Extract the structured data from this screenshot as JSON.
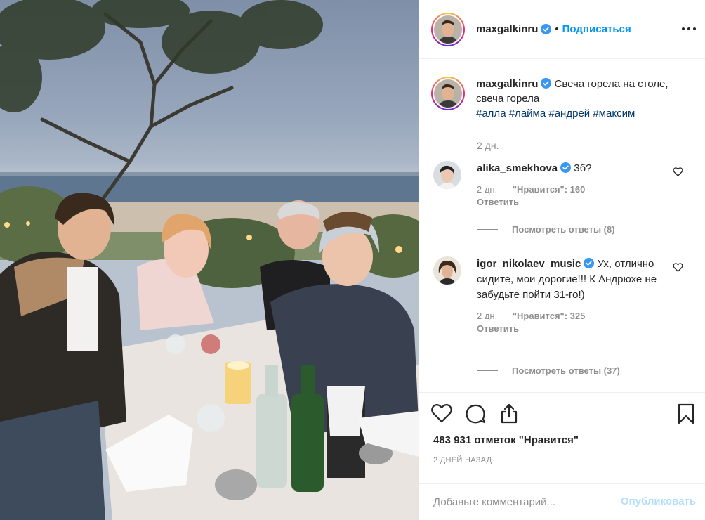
{
  "photo": {
    "alt": ""
  },
  "header": {
    "username": "maxgalkinru",
    "separator": "•",
    "follow_label": "Подписаться"
  },
  "caption": {
    "username": "maxgalkinru",
    "text": "Свеча горела на столе, свеча горела",
    "hashtags": [
      "#алла",
      "#лайма",
      "#андрей",
      "#максим"
    ],
    "time": "2 дн."
  },
  "comments": [
    {
      "username": "alika_smekhova",
      "text": "3б?",
      "time": "2 дн.",
      "likes": "\"Нравится\": 160",
      "reply": "Ответить",
      "view_replies": "Посмотреть ответы (8)"
    },
    {
      "username": "igor_nikolaev_music",
      "text": "Ух, отлично сидите, мои дорогие!!! К Андрюхе не забудьте пойти 31-го!)",
      "time": "2 дн.",
      "likes": "\"Нравится\": 325",
      "reply": "Ответить",
      "view_replies": "Посмотреть ответы (37)"
    }
  ],
  "actions": {
    "icons": [
      "heart-icon",
      "comment-icon",
      "share-icon",
      "bookmark-icon"
    ],
    "likes_text": "483 931 отметок \"Нравится\"",
    "posted_ago": "2 ДНЕЙ НАЗАД"
  },
  "add_comment": {
    "placeholder": "Добавьте комментарий...",
    "publish_label": "Опубликовать"
  },
  "colors": {
    "accent": "#0095f6",
    "verified": "#3897f0",
    "muted": "#8e8e8e",
    "publish_disabled": "#b2dffc",
    "hashtag": "#00376b"
  }
}
